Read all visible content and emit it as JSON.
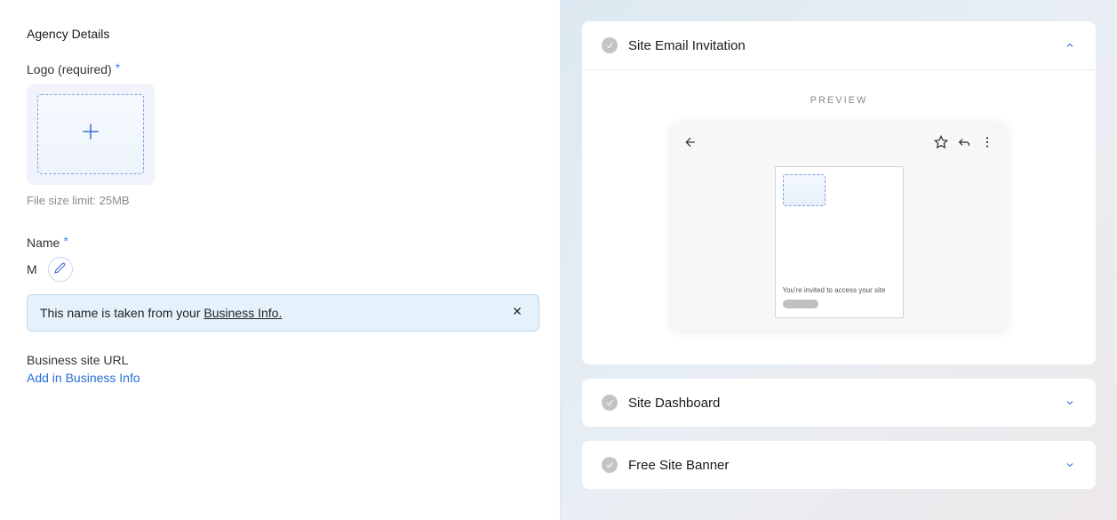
{
  "left": {
    "section_title": "Agency Details",
    "logo_label": "Logo (required)",
    "file_hint": "File size limit: 25MB",
    "name_label": "Name",
    "name_value": "M",
    "info_prefix": "This name is taken from your ",
    "info_link": "Business Info.",
    "url_label": "Business site URL",
    "url_link": "Add in Business Info"
  },
  "right": {
    "cards": {
      "email": {
        "title": "Site Email Invitation"
      },
      "dashboard": {
        "title": "Site Dashboard"
      },
      "banner": {
        "title": "Free Site Banner"
      }
    },
    "preview_label": "PREVIEW",
    "email_preview_text": "You're invited to access your site"
  }
}
